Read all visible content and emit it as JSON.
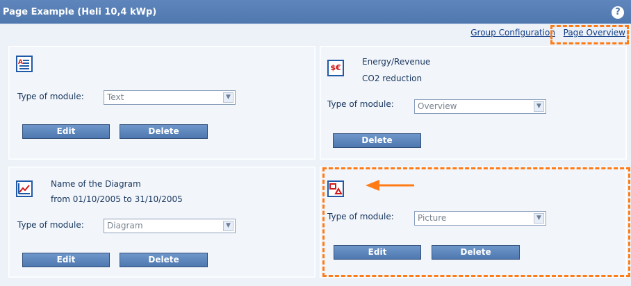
{
  "title": "Page Example (Heli 10,4 kWp)",
  "help_icon": "?",
  "links": {
    "group_configuration": "Group Configuration",
    "page_overview": "Page Overview"
  },
  "labels": {
    "type_of_module": "Type of module:",
    "edit": "Edit",
    "delete": "Delete"
  },
  "modules": {
    "text": {
      "type": "Text"
    },
    "overview": {
      "line1": "Energy/Revenue",
      "line2": "CO2 reduction",
      "type": "Overview"
    },
    "diagram": {
      "line1": "Name of the Diagram",
      "line2": "from 01/10/2005 to 31/10/2005",
      "type": "Diagram"
    },
    "picture": {
      "type": "Picture"
    }
  },
  "icons": {
    "text": "text-module-icon",
    "overview": "currency-module-icon",
    "diagram": "diagram-module-icon",
    "picture": "picture-module-icon",
    "help": "help-icon",
    "arrow": "orange-arrow-icon"
  },
  "colors": {
    "header": "#5f86bc",
    "button": "#5c84bb",
    "highlight": "#ff7b16",
    "link": "#123f86"
  }
}
